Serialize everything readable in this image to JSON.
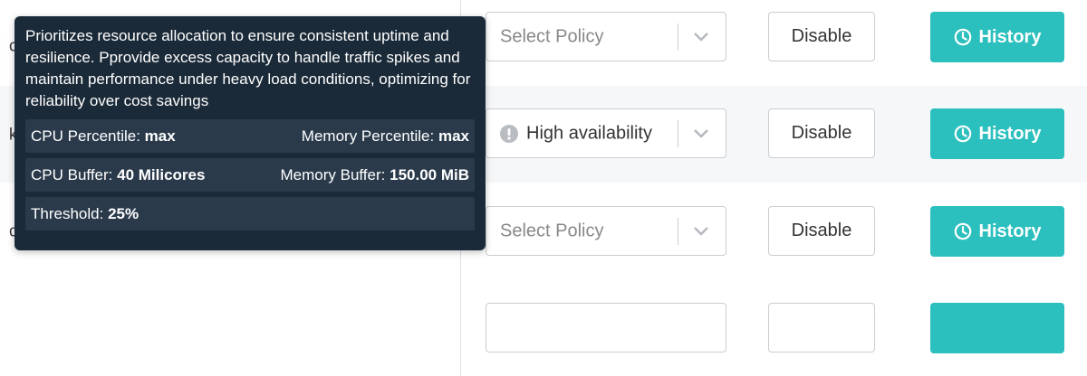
{
  "rows": [
    {
      "name": "c",
      "policy": {
        "value": "",
        "placeholder": "Select Policy"
      },
      "disable_label": "Disable",
      "history_label": "History"
    },
    {
      "name": "k",
      "policy": {
        "value": "High availability",
        "placeholder": "Select Policy",
        "warning": true
      },
      "disable_label": "Disable",
      "history_label": "History"
    },
    {
      "name": "c",
      "policy": {
        "value": "",
        "placeholder": "Select Policy"
      },
      "disable_label": "Disable",
      "history_label": "History"
    }
  ],
  "tooltip": {
    "description": "Prioritizes resource allocation to ensure consistent uptime and resilience. Pprovide excess capacity to handle traffic spikes and maintain performance under heavy load conditions, optimizing for reliability over cost savings",
    "cpu_percentile_label": "CPU Percentile:",
    "cpu_percentile_value": "max",
    "memory_percentile_label": "Memory Percentile:",
    "memory_percentile_value": "max",
    "cpu_buffer_label": "CPU Buffer:",
    "cpu_buffer_value": "40 Milicores",
    "memory_buffer_label": "Memory Buffer:",
    "memory_buffer_value": "150.00 MiB",
    "threshold_label": "Threshold:",
    "threshold_value": "25%"
  },
  "colors": {
    "history_button": "#2bbfbd",
    "tooltip_bg": "#1b2a38",
    "tooltip_row_bg": "#2a3a4b"
  },
  "icons": {
    "history": "clock-icon",
    "select_chevron": "chevron-down-icon",
    "policy_warning": "exclamation-circle-icon"
  }
}
